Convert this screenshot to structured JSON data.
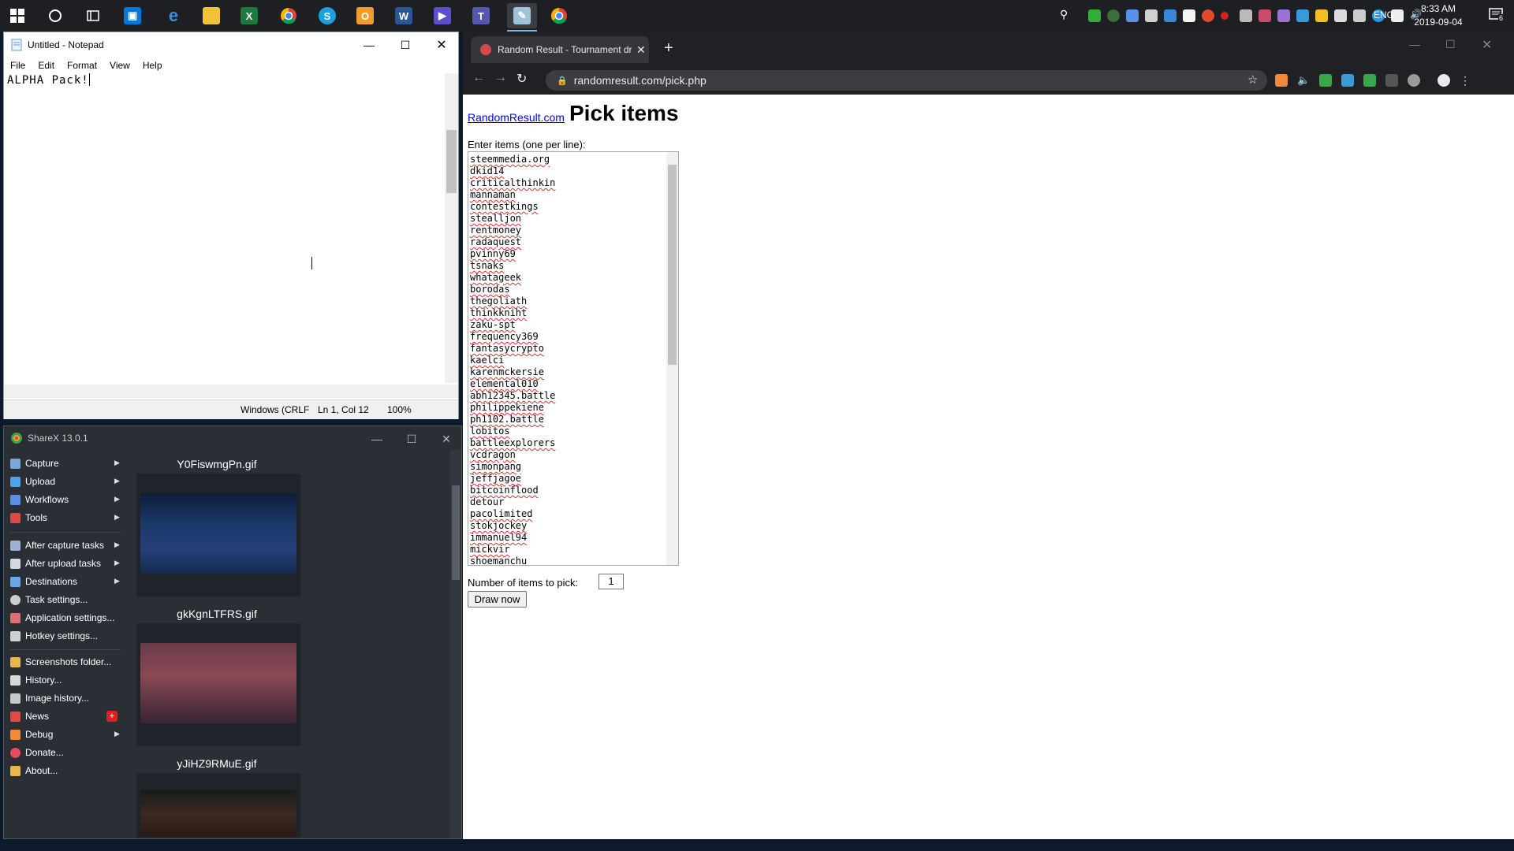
{
  "taskbar": {
    "language": "ENG",
    "time": "8:33 AM",
    "date": "2019-09-04",
    "notification_count": "6"
  },
  "notepad": {
    "title": "Untitled - Notepad",
    "menu": [
      "File",
      "Edit",
      "Format",
      "View",
      "Help"
    ],
    "text": "ALPHA Pack!",
    "status": {
      "encoding": "Windows (CRLF",
      "position": "Ln 1, Col 12",
      "zoom": "100%"
    }
  },
  "sharex": {
    "title": "ShareX 13.0.1",
    "menu_top": [
      {
        "label": "Capture",
        "icon": "capture-icon",
        "color": "#7aa7d8",
        "arrow": true
      },
      {
        "label": "Upload",
        "icon": "upload-arrow-icon",
        "color": "#4aa3f0",
        "arrow": true
      },
      {
        "label": "Workflows",
        "icon": "workflows-icon",
        "color": "#5b8ee6",
        "arrow": true
      },
      {
        "label": "Tools",
        "icon": "tools-icon",
        "color": "#e04848",
        "arrow": true
      }
    ],
    "menu_mid": [
      {
        "label": "After capture tasks",
        "icon": "after-capture-icon",
        "color": "#9db3d6",
        "arrow": true
      },
      {
        "label": "After upload tasks",
        "icon": "cloud-upload-icon",
        "color": "#cfd8e3",
        "arrow": true
      },
      {
        "label": "Destinations",
        "icon": "destinations-icon",
        "color": "#6aa6e8",
        "arrow": true
      },
      {
        "label": "Task settings...",
        "icon": "gear-icon",
        "color": "#cccccc",
        "arrow": false
      },
      {
        "label": "Application settings...",
        "icon": "wrench-icon",
        "color": "#e07070",
        "arrow": false
      },
      {
        "label": "Hotkey settings...",
        "icon": "keyboard-icon",
        "color": "#d0d0d0",
        "arrow": false
      }
    ],
    "menu_bottom": [
      {
        "label": "Screenshots folder...",
        "icon": "folder-icon",
        "color": "#e8b84a",
        "arrow": false
      },
      {
        "label": "History...",
        "icon": "history-icon",
        "color": "#d8d8d8",
        "arrow": false
      },
      {
        "label": "Image history...",
        "icon": "image-history-icon",
        "color": "#c8c8c8",
        "arrow": false
      },
      {
        "label": "News",
        "icon": "megaphone-icon",
        "color": "#e24a4a",
        "arrow": false
      },
      {
        "label": "Debug",
        "icon": "debug-icon",
        "color": "#f08a3a",
        "arrow": true
      },
      {
        "label": "Donate...",
        "icon": "heart-icon",
        "color": "#e84b5a",
        "arrow": false
      },
      {
        "label": "About...",
        "icon": "crown-icon",
        "color": "#e8b84a",
        "arrow": false
      }
    ],
    "thumbnails": [
      {
        "name": "Y0FiswmgPn.gif"
      },
      {
        "name": "gkKgnLTFRS.gif"
      },
      {
        "name": "yJiHZ9RMuE.gif"
      }
    ]
  },
  "browser": {
    "tab_title": "Random Result - Tournament dr",
    "url": "randomresult.com/pick.php",
    "page": {
      "site_link": "RandomResult.com",
      "title": "Pick items",
      "enter_label": "Enter items (one per line):",
      "items": [
        "steemmedia.org",
        "dkid14",
        "criticalthinkin",
        "mannaman",
        "contestkings",
        "stealljon",
        "rentmoney",
        "radaquest",
        "pvinny69",
        "tsnaks",
        "whatageek",
        "borodas",
        "thegoliath",
        "thinkkniht",
        "zaku-spt",
        "frequency369",
        "fantasycrypto",
        "kaelci",
        "karenmckersie",
        "elemental010",
        "abh12345.battle",
        "philippekiene",
        "ph1102.battle",
        "lobitos",
        "battleexplorers",
        "vcdragon",
        "simonpang",
        "jeffjagoe",
        "bitcoinflood",
        "detour",
        "pacolimited",
        "stokjockey",
        "immanuel94",
        "mickvir",
        "shoemanchu"
      ],
      "num_label": "Number of items to pick:",
      "num_value": "1",
      "draw_button": "Draw now"
    }
  }
}
